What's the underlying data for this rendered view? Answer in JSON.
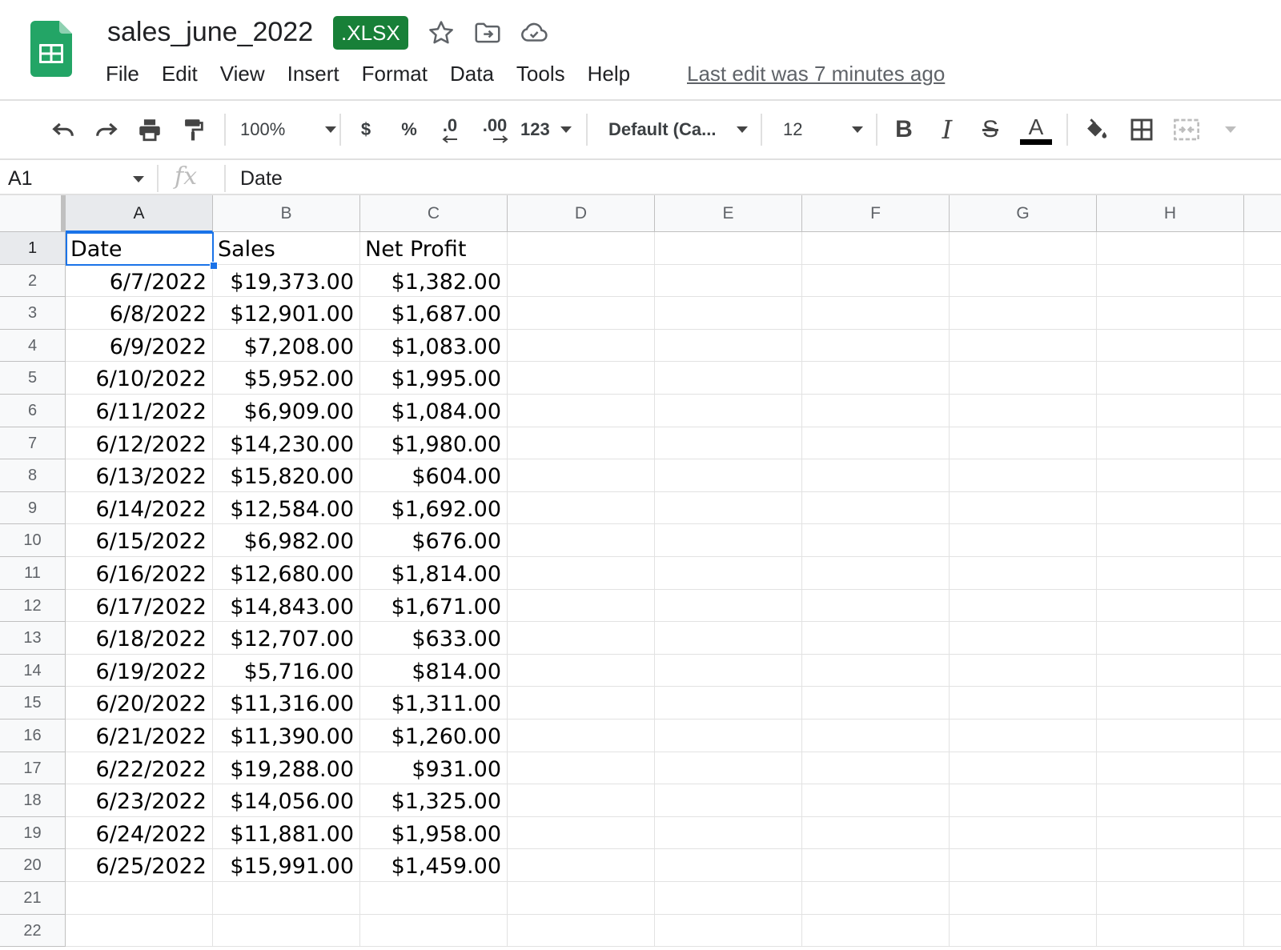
{
  "document": {
    "title": "sales_june_2022",
    "badge": ".XLSX",
    "icons": [
      "sheets-logo-icon",
      "star-icon",
      "move-folder-icon",
      "cloud-status-icon"
    ]
  },
  "menu": {
    "items": [
      "File",
      "Edit",
      "View",
      "Insert",
      "Format",
      "Data",
      "Tools",
      "Help"
    ],
    "last_edit": "Last edit was 7 minutes ago"
  },
  "toolbar": {
    "zoom": "100%",
    "currency": "$",
    "percent": "%",
    "decrease_decimals": ".0",
    "increase_decimals": ".00",
    "more_formats": "123",
    "font": "Default (Ca...",
    "font_size": "12",
    "bold": "B",
    "italic": "I",
    "strikethrough": "S",
    "text_color": "A",
    "text_color_value": "#000000",
    "icons": [
      "undo-icon",
      "redo-icon",
      "print-icon",
      "paint-format-icon",
      "fill-color-icon",
      "borders-icon",
      "merge-cells-icon"
    ]
  },
  "formula_bar": {
    "name_box": "A1",
    "fx": "fx",
    "value": "Date"
  },
  "grid": {
    "columns": [
      "A",
      "B",
      "C",
      "D",
      "E",
      "F",
      "G",
      "H"
    ],
    "active_column": "A",
    "active_row": 1,
    "selected_cell": "A1",
    "visible_row_numbers": [
      1,
      2,
      3,
      4,
      5,
      6,
      7,
      8,
      9,
      10,
      11,
      12,
      13,
      14,
      15,
      16,
      17,
      18,
      19,
      20,
      21,
      22
    ],
    "headers": [
      "Date",
      "Sales",
      "Net Profit"
    ],
    "rows": [
      [
        "6/7/2022",
        "$19,373.00",
        "$1,382.00"
      ],
      [
        "6/8/2022",
        "$12,901.00",
        "$1,687.00"
      ],
      [
        "6/9/2022",
        "$7,208.00",
        "$1,083.00"
      ],
      [
        "6/10/2022",
        "$5,952.00",
        "$1,995.00"
      ],
      [
        "6/11/2022",
        "$6,909.00",
        "$1,084.00"
      ],
      [
        "6/12/2022",
        "$14,230.00",
        "$1,980.00"
      ],
      [
        "6/13/2022",
        "$15,820.00",
        "$604.00"
      ],
      [
        "6/14/2022",
        "$12,584.00",
        "$1,692.00"
      ],
      [
        "6/15/2022",
        "$6,982.00",
        "$676.00"
      ],
      [
        "6/16/2022",
        "$12,680.00",
        "$1,814.00"
      ],
      [
        "6/17/2022",
        "$14,843.00",
        "$1,671.00"
      ],
      [
        "6/18/2022",
        "$12,707.00",
        "$633.00"
      ],
      [
        "6/19/2022",
        "$5,716.00",
        "$814.00"
      ],
      [
        "6/20/2022",
        "$11,316.00",
        "$1,311.00"
      ],
      [
        "6/21/2022",
        "$11,390.00",
        "$1,260.00"
      ],
      [
        "6/22/2022",
        "$19,288.00",
        "$931.00"
      ],
      [
        "6/23/2022",
        "$14,056.00",
        "$1,325.00"
      ],
      [
        "6/24/2022",
        "$11,881.00",
        "$1,958.00"
      ],
      [
        "6/25/2022",
        "$15,991.00",
        "$1,459.00"
      ]
    ]
  },
  "colors": {
    "brand_green": "#188038",
    "selection_blue": "#1a73e8",
    "header_bg": "#f8f9fa"
  }
}
